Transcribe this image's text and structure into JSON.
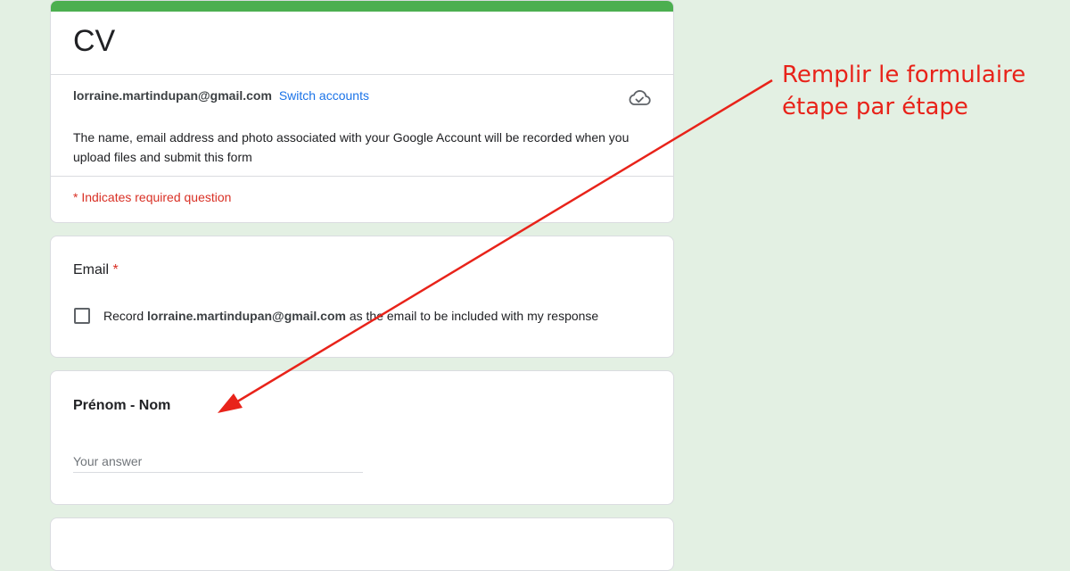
{
  "form": {
    "title": "CV",
    "accent_color": "#4caf50",
    "account_email": "lorraine.martindupan@gmail.com",
    "switch_accounts_label": "Switch accounts",
    "cloud_icon": "cloud-saved-icon",
    "notice": "The name, email address and photo associated with your Google Account will be recorded when you upload files and submit this form",
    "required_note": "* Indicates required question"
  },
  "questions": {
    "email": {
      "title": "Email",
      "required_marker": "*",
      "checkbox_prefix": "Record",
      "checkbox_email": "lorraine.martindupan@gmail.com",
      "checkbox_suffix": "as the email to be included with my response",
      "checked": false
    },
    "name": {
      "title": "Prénom - Nom",
      "placeholder": "Your answer",
      "value": ""
    }
  },
  "annotation": {
    "line1": "Remplir le formulaire",
    "line2": "étape par étape",
    "color": "#e8231a"
  }
}
